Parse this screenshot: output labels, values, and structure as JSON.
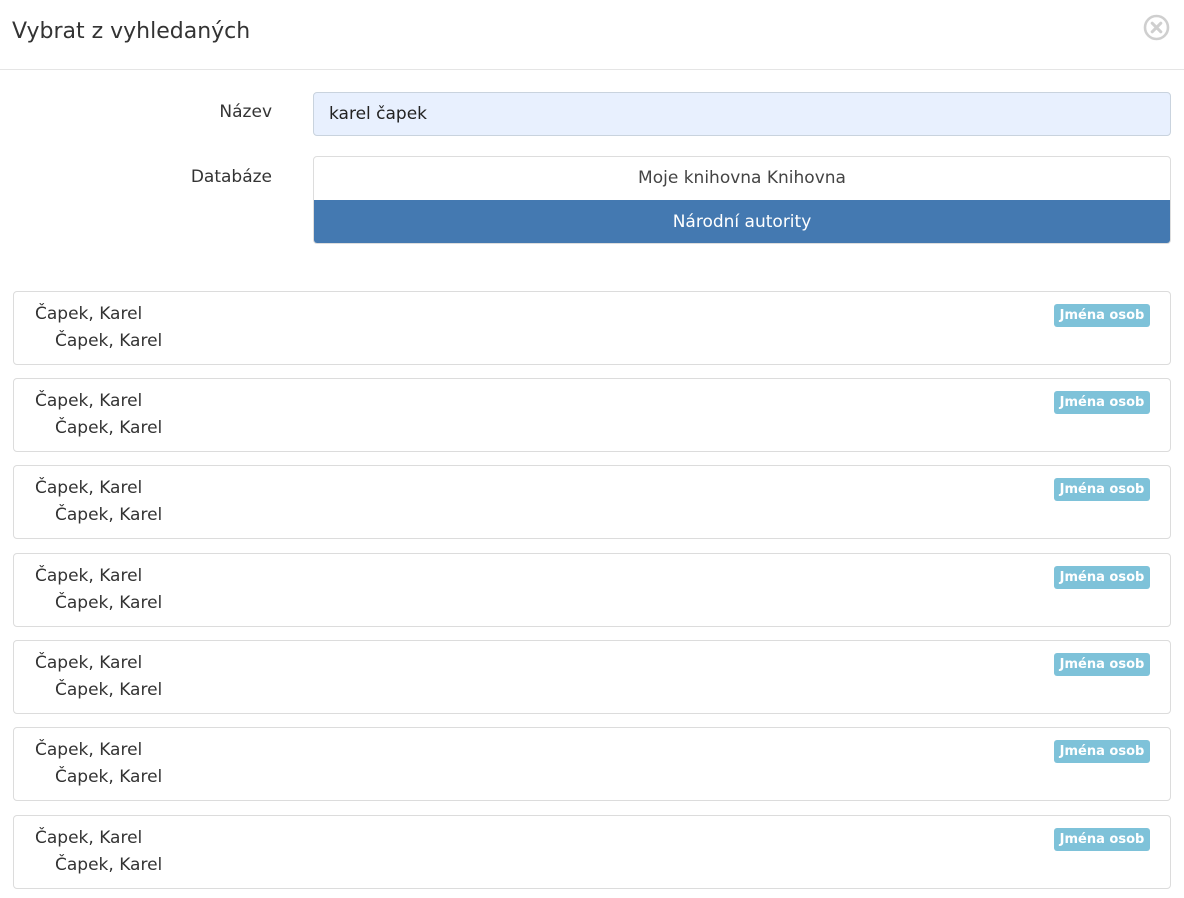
{
  "modal": {
    "title": "Vybrat z vyhledaných",
    "close_icon": "close-circle-icon"
  },
  "form": {
    "name_label": "Název",
    "name_value": "karel čapek",
    "database_label": "Databáze",
    "databases": [
      {
        "label": "Moje knihovna Knihovna",
        "selected": false
      },
      {
        "label": "Národní autority",
        "selected": true
      }
    ]
  },
  "colors": {
    "selected_database": "#4479b1",
    "badge": "#7ec2d9",
    "input_background": "#e8f0fe"
  },
  "results": [
    {
      "primary": "Čapek, Karel",
      "secondary": "Čapek, Karel",
      "badge": "Jména osob"
    },
    {
      "primary": "Čapek, Karel",
      "secondary": "Čapek, Karel",
      "badge": "Jména osob"
    },
    {
      "primary": "Čapek, Karel",
      "secondary": "Čapek, Karel",
      "badge": "Jména osob"
    },
    {
      "primary": "Čapek, Karel",
      "secondary": "Čapek, Karel",
      "badge": "Jména osob"
    },
    {
      "primary": "Čapek, Karel",
      "secondary": "Čapek, Karel",
      "badge": "Jména osob"
    },
    {
      "primary": "Čapek, Karel",
      "secondary": "Čapek, Karel",
      "badge": "Jména osob"
    },
    {
      "primary": "Čapek, Karel",
      "secondary": "Čapek, Karel",
      "badge": "Jména osob"
    }
  ]
}
